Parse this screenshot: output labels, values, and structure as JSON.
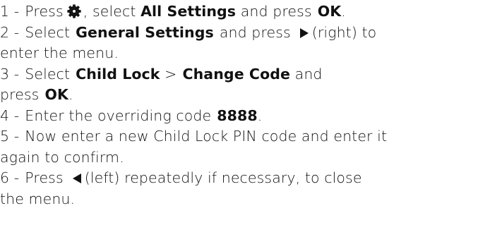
{
  "steps": [
    {
      "num": "1 -",
      "t1": "Press",
      "icon": "gear-icon",
      "t2": ", select",
      "b1": "All Settings",
      "t3": "and press",
      "b2": "OK",
      "t4": "."
    },
    {
      "num": "2 -",
      "t1": "Select",
      "b1": "General Settings",
      "t2": "and press",
      "icon": "right-arrow-icon",
      "t3": "(right) to",
      "t4": "enter the menu."
    },
    {
      "num": "3 -",
      "t1": "Select",
      "b1": "Child Lock",
      "t2": ">",
      "b2": "Change Code",
      "t3": "and",
      "t4": "press",
      "b3": "OK",
      "t5": "."
    },
    {
      "num": "4 -",
      "t1": "Enter the overriding code",
      "b1": "8888",
      "t2": "."
    },
    {
      "num": "5 -",
      "t1": "Now enter a new Child Lock PIN code and enter it",
      "t2": "again to confirm."
    },
    {
      "num": "6 -",
      "t1": "Press",
      "icon": "left-arrow-icon",
      "t2": "(left) repeatedly if necessary, to close",
      "t3": "the menu."
    }
  ]
}
